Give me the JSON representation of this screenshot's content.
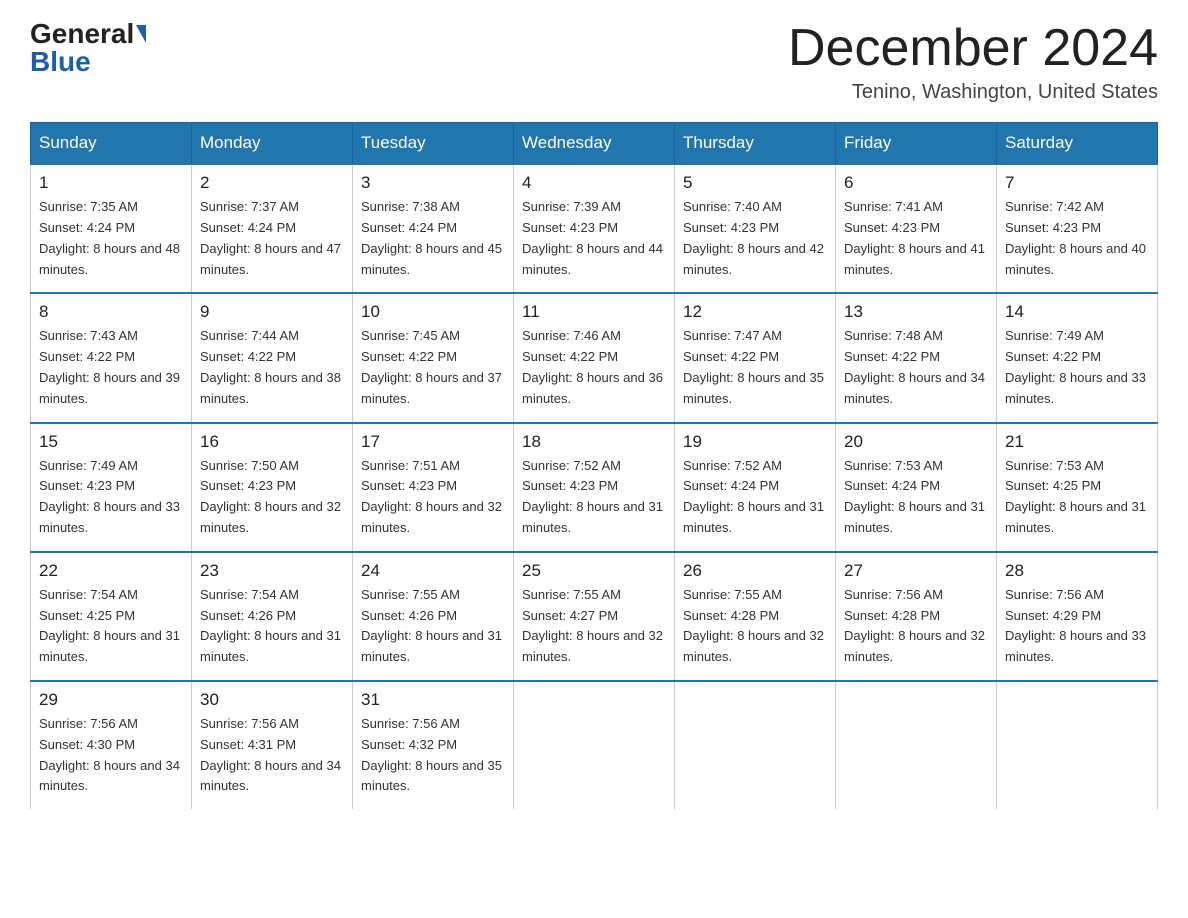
{
  "header": {
    "logo_general": "General",
    "logo_blue": "Blue",
    "month_title": "December 2024",
    "location": "Tenino, Washington, United States"
  },
  "days_of_week": [
    "Sunday",
    "Monday",
    "Tuesday",
    "Wednesday",
    "Thursday",
    "Friday",
    "Saturday"
  ],
  "weeks": [
    [
      {
        "day": "1",
        "sunrise": "7:35 AM",
        "sunset": "4:24 PM",
        "daylight": "8 hours and 48 minutes."
      },
      {
        "day": "2",
        "sunrise": "7:37 AM",
        "sunset": "4:24 PM",
        "daylight": "8 hours and 47 minutes."
      },
      {
        "day": "3",
        "sunrise": "7:38 AM",
        "sunset": "4:24 PM",
        "daylight": "8 hours and 45 minutes."
      },
      {
        "day": "4",
        "sunrise": "7:39 AM",
        "sunset": "4:23 PM",
        "daylight": "8 hours and 44 minutes."
      },
      {
        "day": "5",
        "sunrise": "7:40 AM",
        "sunset": "4:23 PM",
        "daylight": "8 hours and 42 minutes."
      },
      {
        "day": "6",
        "sunrise": "7:41 AM",
        "sunset": "4:23 PM",
        "daylight": "8 hours and 41 minutes."
      },
      {
        "day": "7",
        "sunrise": "7:42 AM",
        "sunset": "4:23 PM",
        "daylight": "8 hours and 40 minutes."
      }
    ],
    [
      {
        "day": "8",
        "sunrise": "7:43 AM",
        "sunset": "4:22 PM",
        "daylight": "8 hours and 39 minutes."
      },
      {
        "day": "9",
        "sunrise": "7:44 AM",
        "sunset": "4:22 PM",
        "daylight": "8 hours and 38 minutes."
      },
      {
        "day": "10",
        "sunrise": "7:45 AM",
        "sunset": "4:22 PM",
        "daylight": "8 hours and 37 minutes."
      },
      {
        "day": "11",
        "sunrise": "7:46 AM",
        "sunset": "4:22 PM",
        "daylight": "8 hours and 36 minutes."
      },
      {
        "day": "12",
        "sunrise": "7:47 AM",
        "sunset": "4:22 PM",
        "daylight": "8 hours and 35 minutes."
      },
      {
        "day": "13",
        "sunrise": "7:48 AM",
        "sunset": "4:22 PM",
        "daylight": "8 hours and 34 minutes."
      },
      {
        "day": "14",
        "sunrise": "7:49 AM",
        "sunset": "4:22 PM",
        "daylight": "8 hours and 33 minutes."
      }
    ],
    [
      {
        "day": "15",
        "sunrise": "7:49 AM",
        "sunset": "4:23 PM",
        "daylight": "8 hours and 33 minutes."
      },
      {
        "day": "16",
        "sunrise": "7:50 AM",
        "sunset": "4:23 PM",
        "daylight": "8 hours and 32 minutes."
      },
      {
        "day": "17",
        "sunrise": "7:51 AM",
        "sunset": "4:23 PM",
        "daylight": "8 hours and 32 minutes."
      },
      {
        "day": "18",
        "sunrise": "7:52 AM",
        "sunset": "4:23 PM",
        "daylight": "8 hours and 31 minutes."
      },
      {
        "day": "19",
        "sunrise": "7:52 AM",
        "sunset": "4:24 PM",
        "daylight": "8 hours and 31 minutes."
      },
      {
        "day": "20",
        "sunrise": "7:53 AM",
        "sunset": "4:24 PM",
        "daylight": "8 hours and 31 minutes."
      },
      {
        "day": "21",
        "sunrise": "7:53 AM",
        "sunset": "4:25 PM",
        "daylight": "8 hours and 31 minutes."
      }
    ],
    [
      {
        "day": "22",
        "sunrise": "7:54 AM",
        "sunset": "4:25 PM",
        "daylight": "8 hours and 31 minutes."
      },
      {
        "day": "23",
        "sunrise": "7:54 AM",
        "sunset": "4:26 PM",
        "daylight": "8 hours and 31 minutes."
      },
      {
        "day": "24",
        "sunrise": "7:55 AM",
        "sunset": "4:26 PM",
        "daylight": "8 hours and 31 minutes."
      },
      {
        "day": "25",
        "sunrise": "7:55 AM",
        "sunset": "4:27 PM",
        "daylight": "8 hours and 32 minutes."
      },
      {
        "day": "26",
        "sunrise": "7:55 AM",
        "sunset": "4:28 PM",
        "daylight": "8 hours and 32 minutes."
      },
      {
        "day": "27",
        "sunrise": "7:56 AM",
        "sunset": "4:28 PM",
        "daylight": "8 hours and 32 minutes."
      },
      {
        "day": "28",
        "sunrise": "7:56 AM",
        "sunset": "4:29 PM",
        "daylight": "8 hours and 33 minutes."
      }
    ],
    [
      {
        "day": "29",
        "sunrise": "7:56 AM",
        "sunset": "4:30 PM",
        "daylight": "8 hours and 34 minutes."
      },
      {
        "day": "30",
        "sunrise": "7:56 AM",
        "sunset": "4:31 PM",
        "daylight": "8 hours and 34 minutes."
      },
      {
        "day": "31",
        "sunrise": "7:56 AM",
        "sunset": "4:32 PM",
        "daylight": "8 hours and 35 minutes."
      },
      null,
      null,
      null,
      null
    ]
  ],
  "labels": {
    "sunrise_prefix": "Sunrise: ",
    "sunset_prefix": "Sunset: ",
    "daylight_prefix": "Daylight: "
  }
}
